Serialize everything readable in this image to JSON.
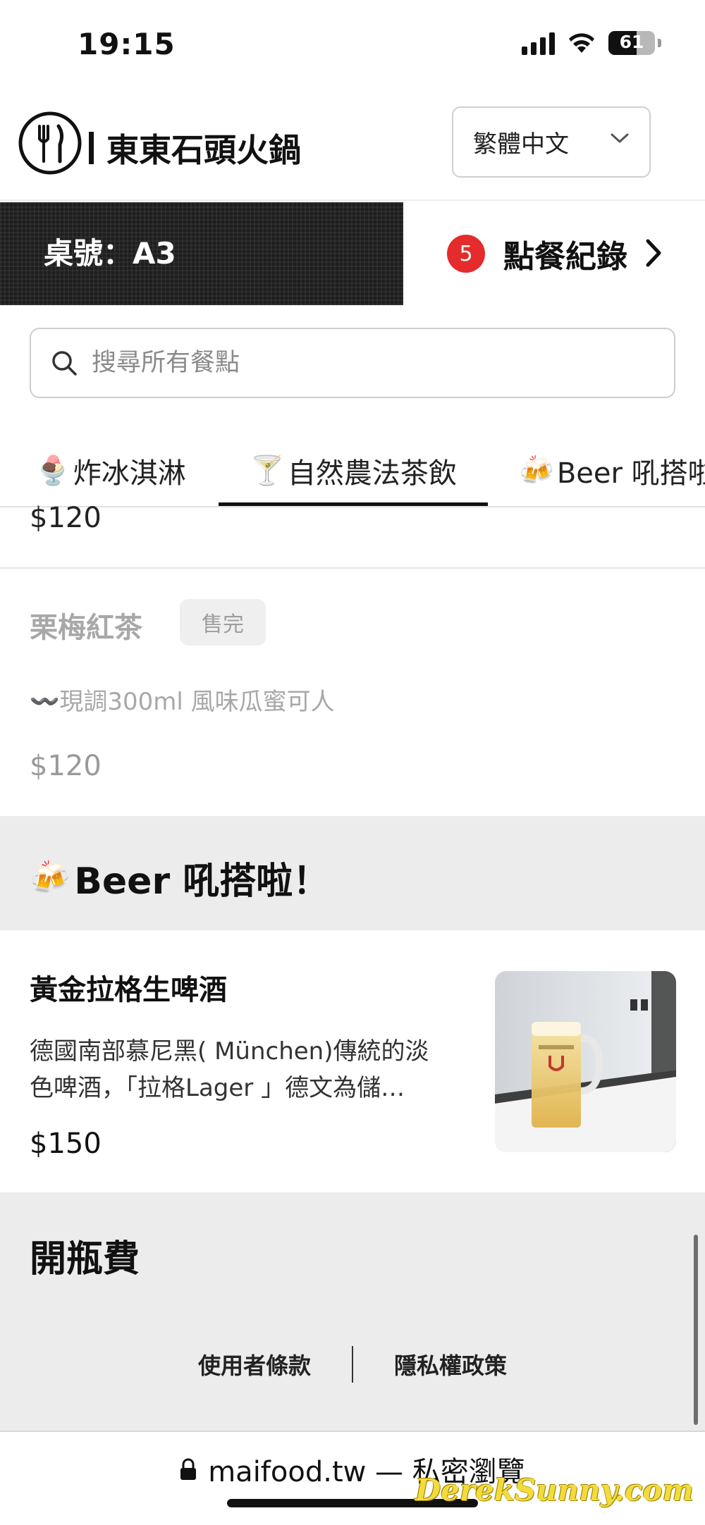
{
  "status_bar": {
    "time": "19:15",
    "battery_level": "61"
  },
  "header": {
    "restaurant_name": "東東石頭火鍋",
    "language": "繁體中文"
  },
  "table_strip": {
    "table_label": "桌號：A3",
    "order_count": "5",
    "order_log_label": "點餐紀錄"
  },
  "search": {
    "placeholder": "搜尋所有餐點"
  },
  "tabs": [
    {
      "emoji": "🍨",
      "label": "炸冰淇淋"
    },
    {
      "emoji": "🍸",
      "label": "自然農法茶飲",
      "active": true
    },
    {
      "emoji": "🍻",
      "label": "Beer 吼搭啦！"
    }
  ],
  "menu": {
    "prev_item_price": "$120",
    "item_sold_out": {
      "name": "栗梅紅茶",
      "badge": "售完",
      "description": "〰️現調300ml 風味瓜蜜可人",
      "price": "$120"
    },
    "beer_section": {
      "emoji": "🍻",
      "title": "Beer 吼搭啦！",
      "item": {
        "name": "黃金拉格生啤酒",
        "description_line1": "德國南部慕尼黑( München)傳統的淡",
        "description_line2": "色啤酒，「拉格Lager 」德文為儲…",
        "price": "$150"
      }
    },
    "corkage_section": {
      "title": "開瓶費"
    }
  },
  "footer": {
    "terms": "使用者條款",
    "privacy": "隱私權政策"
  },
  "browser": {
    "url": "maifood.tw — 私密瀏覽"
  },
  "watermark": "DerekSunny.com",
  "colors": {
    "badge_red": "#e52b2b",
    "section_bg": "#ececec",
    "table_strip_bg": "#1e1e1e",
    "muted_text": "#9e9e9e"
  }
}
